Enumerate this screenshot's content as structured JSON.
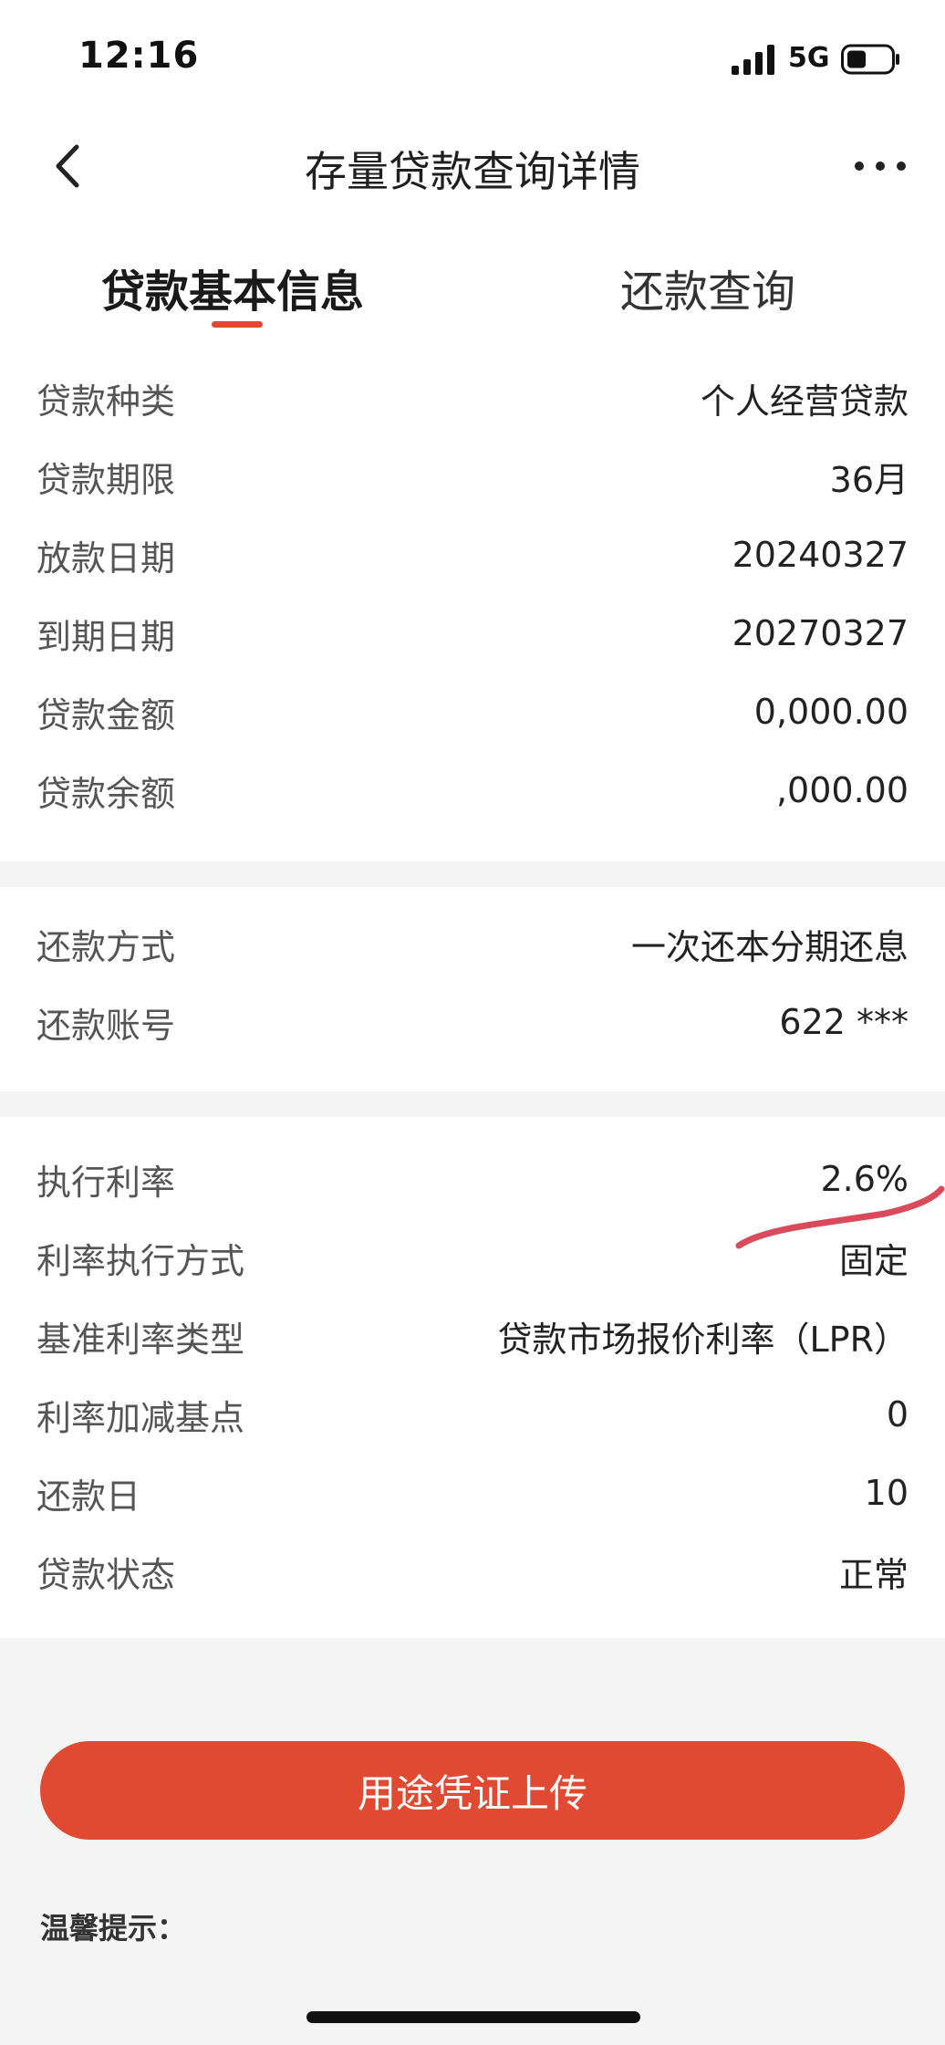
{
  "status_bar": {
    "time": "12:16",
    "network": "5G",
    "icons": [
      "signal-icon",
      "battery-icon"
    ]
  },
  "nav": {
    "title": "存量贷款查询详情",
    "back_icon": "chevron-left-icon",
    "more_icon": "more-horizontal-icon"
  },
  "tabs": [
    {
      "label": "贷款基本信息",
      "active": true
    },
    {
      "label": "还款查询",
      "active": false
    }
  ],
  "section1": [
    {
      "label": "贷款种类",
      "value": "个人经营贷款"
    },
    {
      "label": "贷款期限",
      "value": "36月"
    },
    {
      "label": "放款日期",
      "value": "20240327"
    },
    {
      "label": "到期日期",
      "value": "20270327"
    },
    {
      "label": "贷款金额",
      "value": "0,000.00"
    },
    {
      "label": "贷款余额",
      "value": ",000.00"
    }
  ],
  "section2": [
    {
      "label": "还款方式",
      "value": "一次还本分期还息"
    },
    {
      "label": "还款账号",
      "value": "622  ***  "
    }
  ],
  "section3": [
    {
      "label": "执行利率",
      "value": "2.6%"
    },
    {
      "label": "利率执行方式",
      "value": "固定"
    },
    {
      "label": "基准利率类型",
      "value": "贷款市场报价利率（LPR）"
    },
    {
      "label": "利率加减基点",
      "value": "0"
    },
    {
      "label": "还款日",
      "value": "10"
    },
    {
      "label": "贷款状态",
      "value": "正常"
    }
  ],
  "actions": {
    "upload_button": "用途凭证上传"
  },
  "tip": "温馨提示：",
  "colors": {
    "accent": "#e04a32",
    "gray_bg": "#f4f4f4"
  }
}
